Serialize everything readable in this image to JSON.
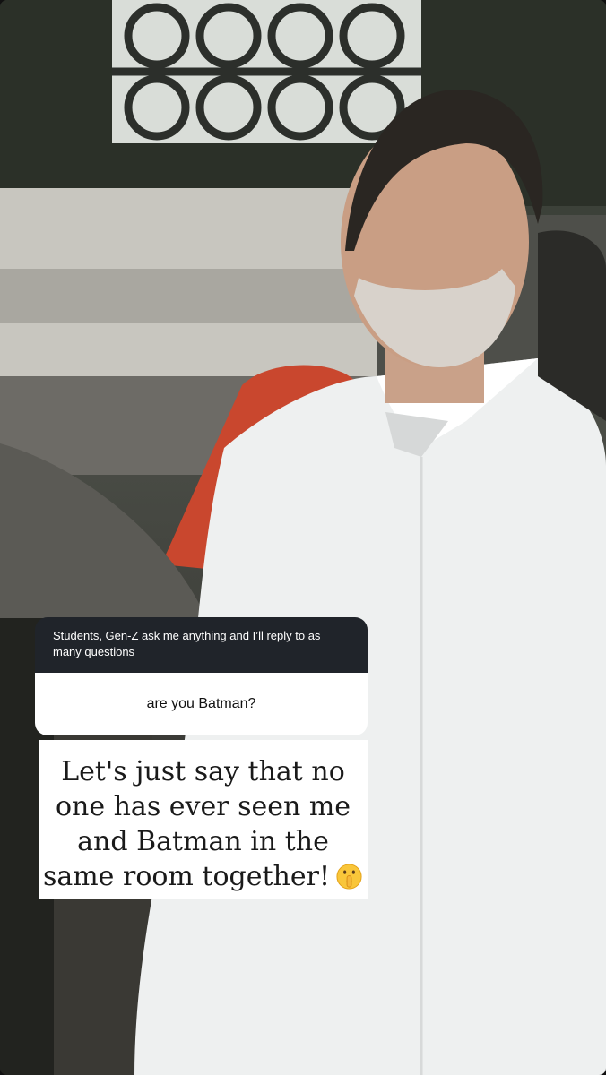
{
  "story": {
    "question_sticker": {
      "prompt": "Students, Gen-Z ask me anything and I’ll reply to as many questions",
      "answer": "are you Batman?"
    },
    "reply": {
      "text": "Let's just say that no one has ever seen me and Batman in the same room together!",
      "emoji_icon": "shushing-face-icon"
    }
  }
}
